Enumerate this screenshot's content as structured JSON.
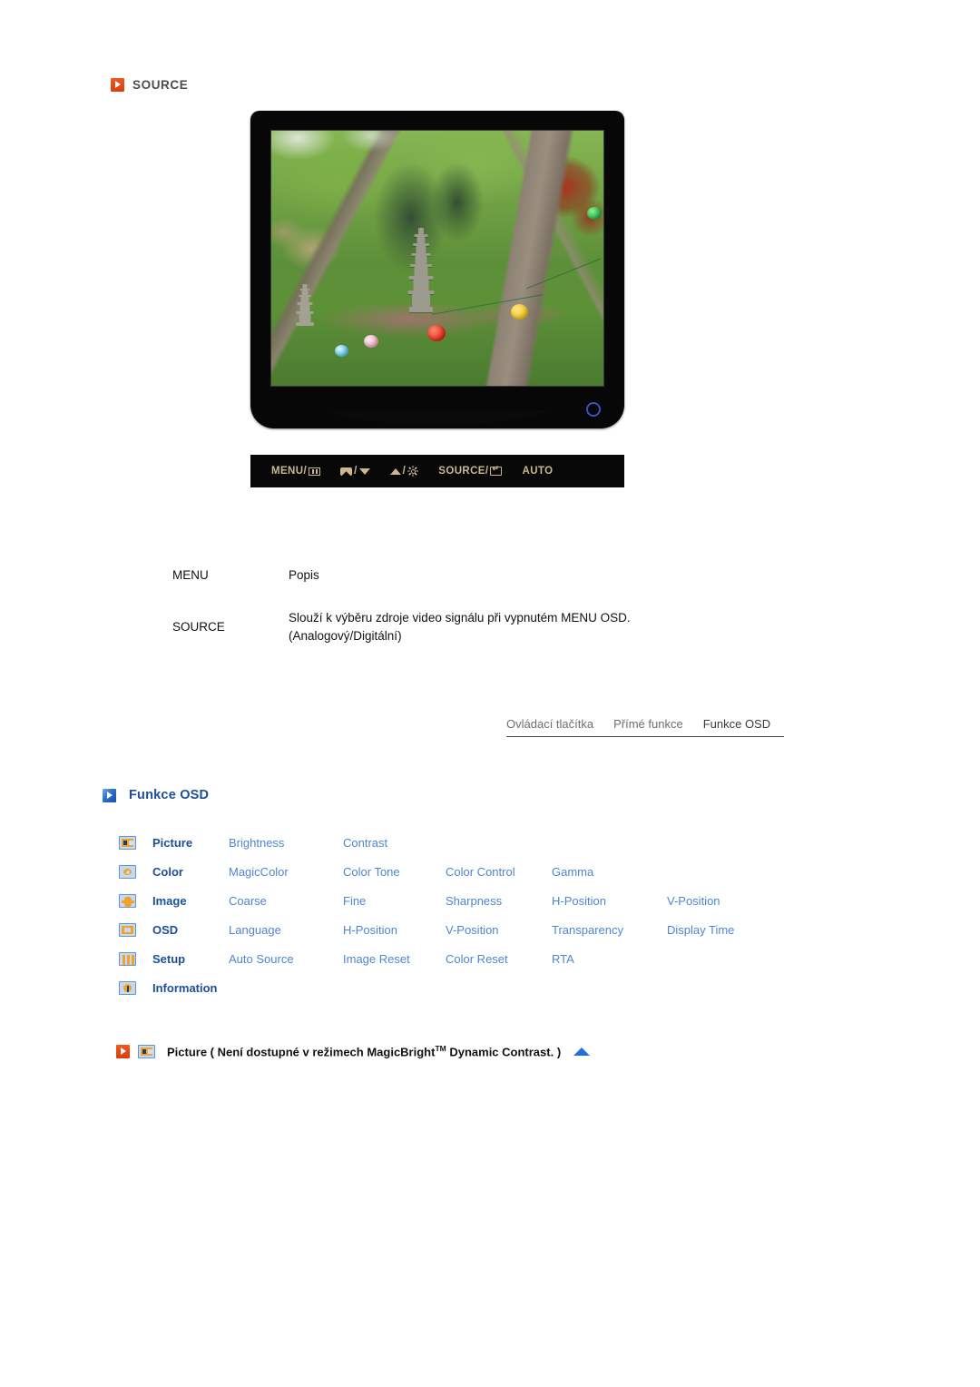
{
  "section": {
    "title": "SOURCE",
    "icon": "orange-play-square-icon",
    "accent_orange": "#e2480f",
    "accent_blue": "#1b4f9c",
    "link_blue": "#4e86d4"
  },
  "monitor": {
    "alt": "LCD monitor front view showing garden photo with stone pagoda and paper lanterns",
    "power_led": "power-led-ring",
    "buttons": [
      {
        "label": "MENU/",
        "glyph": "menu-grid-icon"
      },
      {
        "label": "",
        "glyph": "magicbright-icon",
        "sep": "/",
        "glyph2": "down-arrow-icon"
      },
      {
        "label": "",
        "glyph": "up-arrow-icon",
        "sep": "/",
        "glyph2": "brightness-sun-icon"
      },
      {
        "label": "SOURCE/",
        "glyph": "enter-key-icon"
      },
      {
        "label": "AUTO",
        "glyph": ""
      }
    ]
  },
  "table": {
    "headers": {
      "menu": "MENU",
      "description": "Popis"
    },
    "rows": [
      {
        "menu": "SOURCE",
        "description_line1": "Slouží k výběru zdroje video signálu při vypnutém MENU OSD.",
        "description_line2": "(Analogový/Digitální)"
      }
    ]
  },
  "tabs": [
    {
      "label": "Ovládací tlačítka",
      "active": false
    },
    {
      "label": "Přímé funkce",
      "active": false
    },
    {
      "label": "Funkce OSD",
      "active": true
    }
  ],
  "osd_heading": {
    "title": "Funkce OSD",
    "icon": "blue-play-square-icon"
  },
  "osd_menu": [
    {
      "icon": "picture-icon",
      "name": "Picture",
      "items": [
        "Brightness",
        "Contrast"
      ]
    },
    {
      "icon": "color-icon",
      "name": "Color",
      "items": [
        "MagicColor",
        "Color Tone",
        "Color Control",
        "Gamma"
      ]
    },
    {
      "icon": "image-icon",
      "name": "Image",
      "items": [
        "Coarse",
        "Fine",
        "Sharpness",
        "H-Position",
        "V-Position"
      ]
    },
    {
      "icon": "osd-icon",
      "name": "OSD",
      "items": [
        "Language",
        "H-Position",
        "V-Position",
        "Transparency",
        "Display Time"
      ]
    },
    {
      "icon": "setup-icon",
      "name": "Setup",
      "items": [
        "Auto Source",
        "Image Reset",
        "Color Reset",
        "RTA"
      ]
    },
    {
      "icon": "information-icon",
      "name": "Information",
      "items": []
    }
  ],
  "note": {
    "icon_left": "orange-play-square-icon",
    "icon_menu": "picture-icon",
    "text_part1": "Picture ( Není dostupné v režimech MagicBright",
    "trademark": "TM",
    "text_part2": " Dynamic Contrast. )",
    "back_to_top": "blue-up-triangle-icon"
  }
}
